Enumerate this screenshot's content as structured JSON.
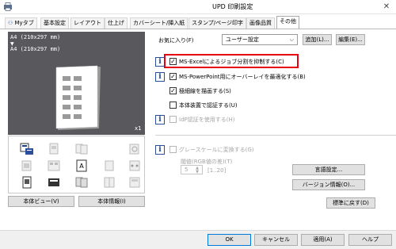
{
  "window": {
    "title": "UPD 印刷設定",
    "close_glyph": "✕"
  },
  "tabs": [
    {
      "label": "Myタブ"
    },
    {
      "label": "基本設定"
    },
    {
      "label": "レイアウト"
    },
    {
      "label": "仕上げ"
    },
    {
      "label": "カバーシート/挿入紙"
    },
    {
      "label": "スタンプ/ページ印字"
    },
    {
      "label": "画像品質"
    },
    {
      "label": "その他"
    }
  ],
  "active_tab": "その他",
  "preview": {
    "paper_size_top": "A4 (210x297 mm)",
    "arrow": "▼",
    "paper_size_bottom": "A4 (210x297 mm)",
    "copies": "x1"
  },
  "left_buttons": {
    "printer_view": "本体ビュー(V)",
    "printer_info": "本体情報(I)"
  },
  "favorites": {
    "label": "お気に入り(F)",
    "selected": "ユーザー設定",
    "add_button": "追加(L)...",
    "edit_button": "編集(E)..."
  },
  "options": [
    {
      "label": "MS-Excelによるジョブ分割を抑制する(C)",
      "checked": true,
      "enabled": true,
      "info": true
    },
    {
      "label": "MS-PowerPoint用にオーバーレイを最適化する(B)",
      "checked": true,
      "enabled": true,
      "info": true
    },
    {
      "label": "極細線を描画する(S)",
      "checked": true,
      "enabled": true,
      "info": false
    },
    {
      "label": "本体装置で認証する(U)",
      "checked": false,
      "enabled": true,
      "info": false
    },
    {
      "label": "IdP認証を使用する(H)",
      "checked": false,
      "enabled": false,
      "info": true
    }
  ],
  "grayscale": {
    "label": "グレースケールに変換する(G)",
    "checked": false,
    "enabled": false,
    "threshold_label": "閾値(RGB値の差)(T)",
    "threshold_value": "5",
    "threshold_range": "[1..20]"
  },
  "side_buttons": {
    "language": "言語設定...",
    "version": "バージョン情報(O)...",
    "defaults": "標準に戻す(D)"
  },
  "dialog_buttons": {
    "ok": "OK",
    "cancel": "キャンセル",
    "apply": "適用(A)",
    "help": "ヘルプ"
  },
  "colors": {
    "highlight": "#e60012",
    "preview_bg": "#59595d",
    "info_blue": "#1a3f99"
  }
}
